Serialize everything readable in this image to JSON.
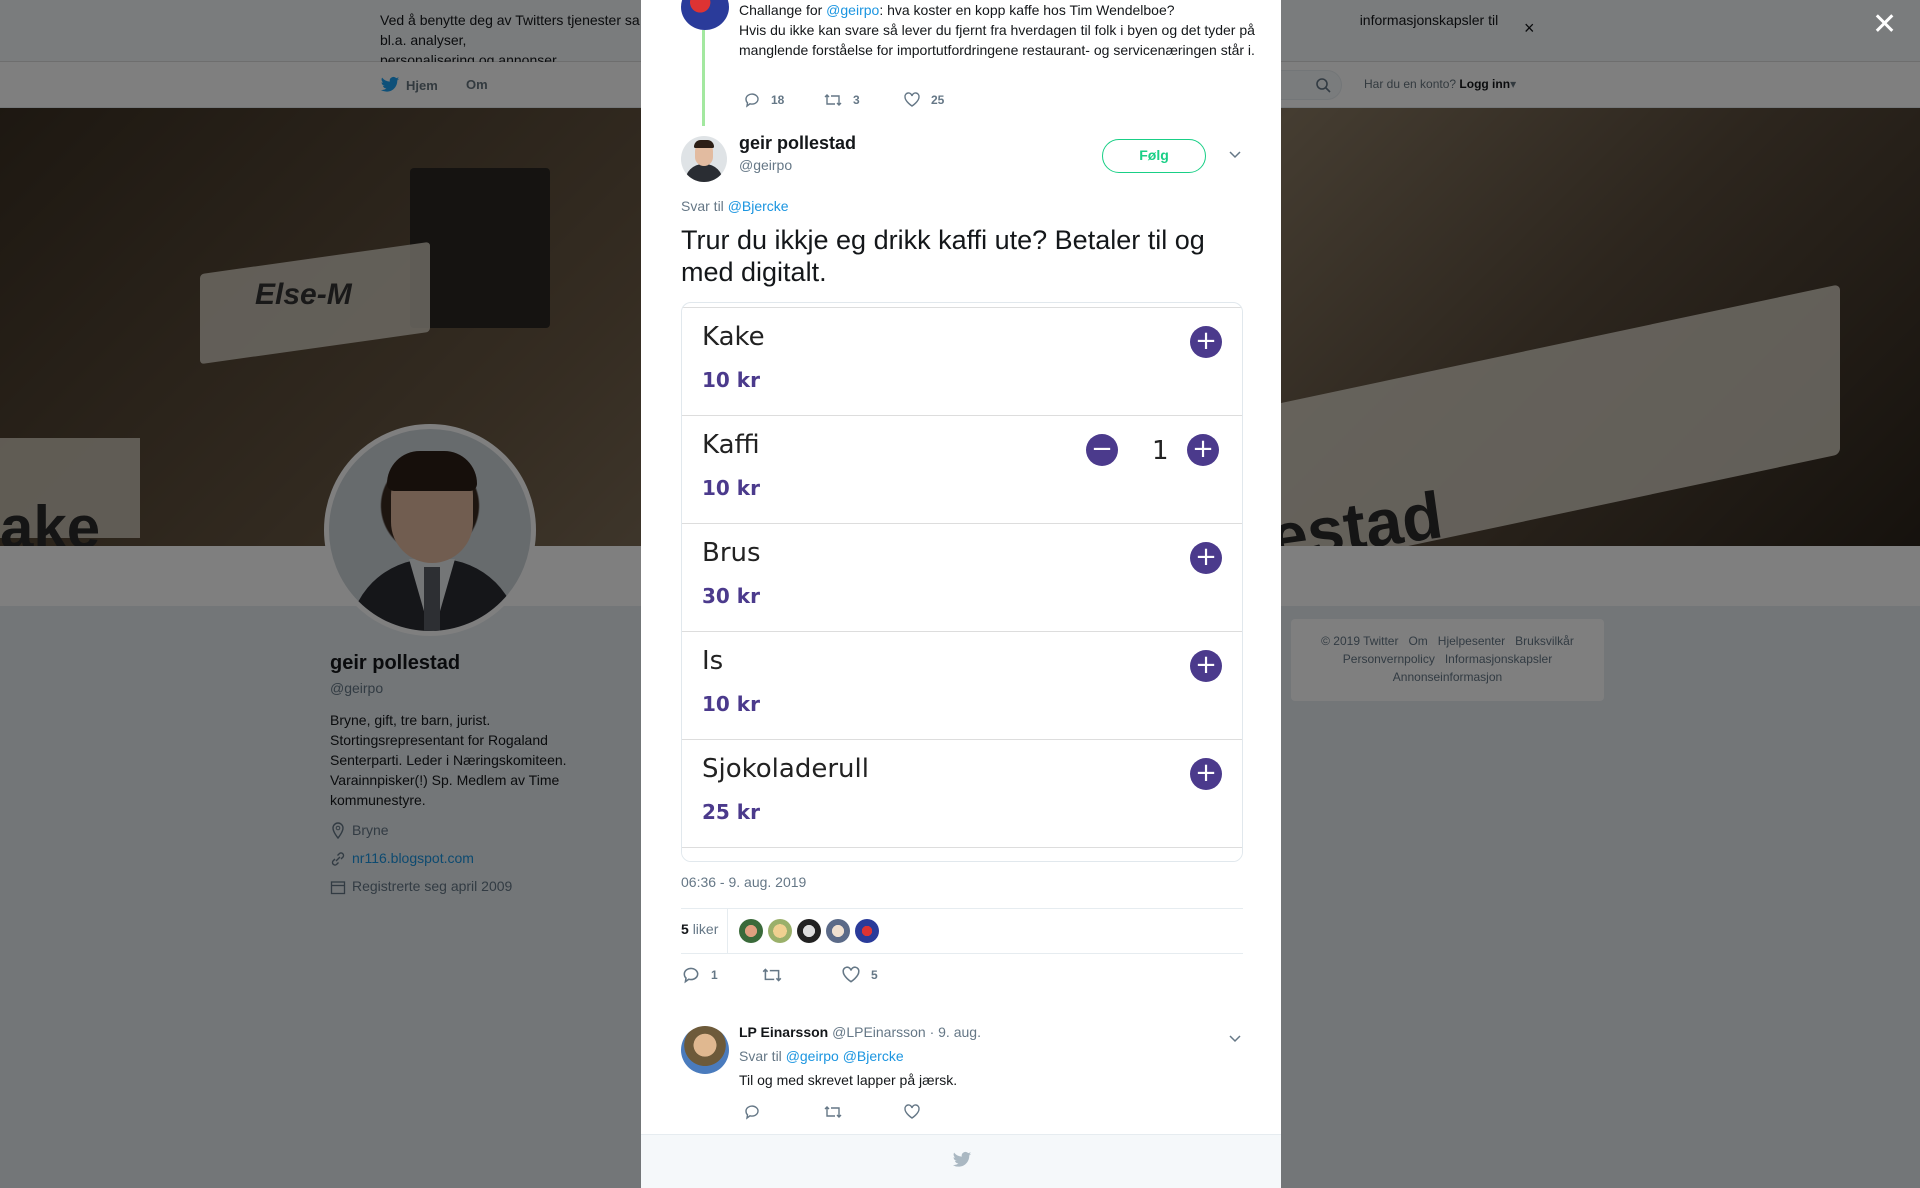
{
  "cookie_banner": {
    "text": "Ved å benytte deg av Twitters tjenester samtykker du i bruken av informasjonskapsler. Twitter og partnere bruker informasjonskapsler til bl.a. analyser, personalisering og annonser.",
    "text_visible_left": "Ved å benytte deg av Twitters tjenester sa",
    "text_visible_right": "informasjonskapsler til bl.a. analyser,",
    "text_line2": "personalisering og annonser.",
    "close": "×"
  },
  "topnav": {
    "home": "Hjem",
    "about": "Om",
    "account_prompt": "Har du en konto?",
    "login": "Logg inn"
  },
  "profile": {
    "name": "geir pollestad",
    "handle": "@geirpo",
    "bio": "Bryne, gift, tre barn, jurist. Stortingsrepresentant for Rogaland Senterparti. Leder i Næringskomiteen. Varainnpisker(!) Sp. Medlem av Time kommunestyre.",
    "location": "Bryne",
    "website": "nr116.blogspot.com",
    "joined": "Registrerte seg april 2009"
  },
  "banner": {
    "plate1": "Else-M",
    "plate2": "estad",
    "plate3": "ake"
  },
  "footer": {
    "copyright": "© 2019 Twitter",
    "about": "Om",
    "help": "Hjelpesenter",
    "terms": "Bruksvilkår",
    "privacy": "Personvernpolicy",
    "cookies": "Informasjonskapsler",
    "ads": "Annonseinformasjon"
  },
  "modal": {
    "close": "✕",
    "prev_tweet": {
      "text_prefix": "Challange for ",
      "mention": "@geirpo",
      "text_suffix": ": hva koster en kopp kaffe hos Tim Wendelboe?",
      "text_body": "Hvis du ikke kan svare så lever du fjernt fra hverdagen til folk i byen og det tyder på manglende forståelse for importutfordringene restaurant- og servicenæringen står i.",
      "replies": "18",
      "retweets": "3",
      "likes": "25"
    },
    "main_tweet": {
      "name": "geir pollestad",
      "handle": "@geirpo",
      "follow": "Følg",
      "reply_to_label": "Svar til",
      "reply_to": "@Bjercke",
      "text": "Trur du ikkje eg drikk kaffi ute? Betaler til og med digitalt.",
      "timestamp": "06:36 - 9. aug. 2019",
      "likes_count": "5",
      "likes_label": "liker",
      "replies": "1",
      "retweets": "",
      "likes": "5"
    },
    "menu_items": [
      {
        "name": "Kake",
        "price": "10 kr"
      },
      {
        "name": "Kaffi",
        "price": "10 kr",
        "qty": "1"
      },
      {
        "name": "Brus",
        "price": "30 kr"
      },
      {
        "name": "Is",
        "price": "10 kr"
      },
      {
        "name": "Sjokoladerull",
        "price": "25 kr"
      }
    ],
    "reply_tweet": {
      "name": "LP Einarsson",
      "handle": "@LPEinarsson",
      "date": "· 9. aug.",
      "reply_to_label": "Svar til",
      "reply_to_1": "@geirpo",
      "reply_to_2": "@Bjercke",
      "text": "Til og med skrevet lapper på jærsk."
    }
  },
  "colors": {
    "link": "#1b95e0",
    "follow": "#19cf86",
    "menu_accent": "#4b3a8c"
  }
}
